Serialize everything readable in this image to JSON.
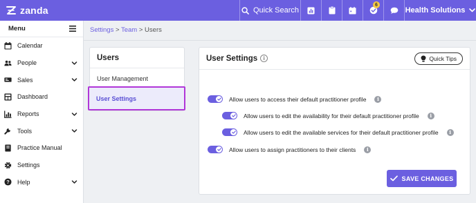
{
  "topbar": {
    "brand": "zanda",
    "search_label": "Quick Search",
    "notification_count": "6",
    "org_name": "Health Solutions",
    "accent_color": "#6b5fe0"
  },
  "sidebar": {
    "menu_label": "Menu",
    "items": [
      {
        "label": "Calendar",
        "icon": "calendar-icon"
      },
      {
        "label": "People",
        "icon": "people-icon",
        "expandable": true
      },
      {
        "label": "Sales",
        "icon": "sales-icon",
        "expandable": true
      },
      {
        "label": "Dashboard",
        "icon": "dashboard-icon"
      },
      {
        "label": "Reports",
        "icon": "reports-icon",
        "expandable": true
      },
      {
        "label": "Tools",
        "icon": "wrench-icon",
        "expandable": true
      },
      {
        "label": "Practice Manual",
        "icon": "book-icon"
      },
      {
        "label": "Settings",
        "icon": "gear-icon"
      },
      {
        "label": "Help",
        "icon": "help-icon",
        "expandable": true
      }
    ]
  },
  "breadcrumb": {
    "settings": "Settings",
    "sep1": " > ",
    "team": "Team",
    "sep2": " > ",
    "current": "Users"
  },
  "users_panel": {
    "title": "Users",
    "links": [
      {
        "label": "User Management"
      },
      {
        "label": "User Settings",
        "active": true
      }
    ]
  },
  "settings_panel": {
    "title": "User Settings",
    "quick_tips_label": "Quick Tips",
    "options": [
      {
        "label": "Allow users to access their default practitioner profile",
        "enabled": true
      },
      {
        "label": "Allow users to edit the availability for their default practitioner profile",
        "enabled": true
      },
      {
        "label": "Allow users to edit the available services for their default practitioner profile",
        "enabled": true
      },
      {
        "label": "Allow users to assign practitioners to their clients",
        "enabled": true
      }
    ],
    "save_label": "SAVE CHANGES"
  }
}
